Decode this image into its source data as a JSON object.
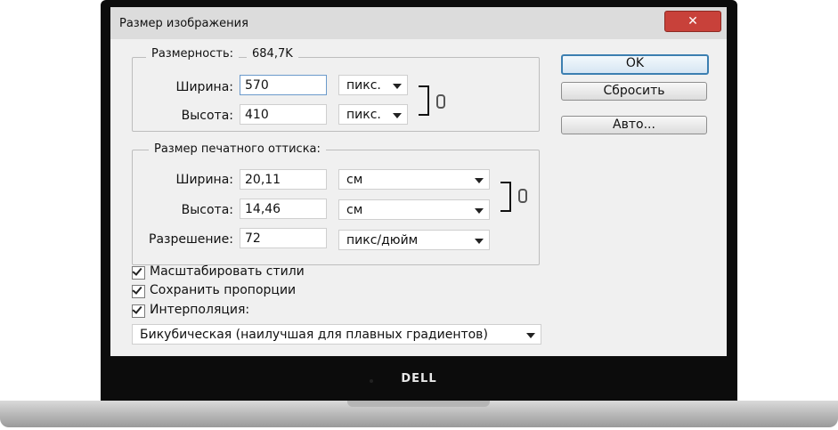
{
  "device": {
    "brand_logo": "DELL"
  },
  "dialog": {
    "title": "Размер изображения",
    "close_symbol": "✕",
    "pixel_dimensions": {
      "legend": "Размерность:",
      "size_value": "684,7K",
      "width_label": "Ширина:",
      "width_value": "570",
      "width_unit": "пикс.",
      "height_label": "Высота:",
      "height_value": "410",
      "height_unit": "пикс."
    },
    "document_size": {
      "legend": "Размер печатного оттиска:",
      "width_label": "Ширина:",
      "width_value": "20,11",
      "width_unit": "см",
      "height_label": "Высота:",
      "height_value": "14,46",
      "height_unit": "см",
      "resolution_label": "Разрешение:",
      "resolution_value": "72",
      "resolution_unit": "пикс/дюйм"
    },
    "checkboxes": [
      {
        "label": "Масштабировать стили",
        "checked": true
      },
      {
        "label": "Сохранить пропорции",
        "checked": true
      },
      {
        "label": "Интерполяция:",
        "checked": true
      }
    ],
    "interpolation_method": "Бикубическая (наилучшая для плавных градиентов)",
    "buttons": {
      "ok": "OK",
      "reset": "Сбросить",
      "auto": "Авто..."
    },
    "link_icon": "chain-link-icon"
  }
}
